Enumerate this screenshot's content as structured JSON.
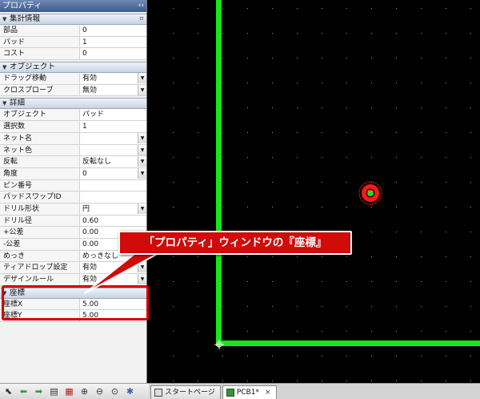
{
  "panel": {
    "title": "プロパティ",
    "collapse_glyph": "‹‹",
    "sections": {
      "summary": {
        "title": "集計情報",
        "rows": [
          {
            "label": "部品",
            "value": "0"
          },
          {
            "label": "パッド",
            "value": "1"
          },
          {
            "label": "コスト",
            "value": "0"
          }
        ]
      },
      "object": {
        "title": "オブジェクト",
        "rows": [
          {
            "label": "ドラッグ移動",
            "value": "有効"
          },
          {
            "label": "クロスプローブ",
            "value": "無効"
          }
        ]
      },
      "detail": {
        "title": "詳細",
        "rows": [
          {
            "label": "オブジェクト",
            "value": "パッド"
          },
          {
            "label": "選択数",
            "value": "1"
          },
          {
            "label": "ネット名",
            "value": ""
          },
          {
            "label": "ネット色",
            "value": ""
          },
          {
            "label": "反転",
            "value": "反転なし"
          },
          {
            "label": "角度",
            "value": "0"
          },
          {
            "label": "ピン番号",
            "value": ""
          },
          {
            "label": "パッドスワップID",
            "value": ""
          },
          {
            "label": "ドリル形状",
            "value": "円"
          },
          {
            "label": "ドリル径",
            "value": "0.60"
          },
          {
            "label": "+公差",
            "value": "0.00"
          },
          {
            "label": "-公差",
            "value": "0.00"
          },
          {
            "label": "めっき",
            "value": "めっきなし"
          },
          {
            "label": "ティアドロップ設定",
            "value": "有効"
          },
          {
            "label": "デザインルール",
            "value": "有効"
          }
        ]
      },
      "coords": {
        "title": "座標",
        "rows": [
          {
            "label": "座標X",
            "value": "5.00"
          },
          {
            "label": "座標Y",
            "value": "5.00"
          }
        ]
      }
    }
  },
  "callout": {
    "text": "「プロパティ」ウィンドウの『座標』"
  },
  "tabs": [
    {
      "label": "スタートページ",
      "icon": "page-icon"
    },
    {
      "label": "PCB1*",
      "icon": "pcb-icon"
    }
  ],
  "colors": {
    "accent_red": "#d10a0a",
    "trace_green": "#19e619",
    "pad_red": "#ff1a1a",
    "canvas_bg": "#000000"
  }
}
